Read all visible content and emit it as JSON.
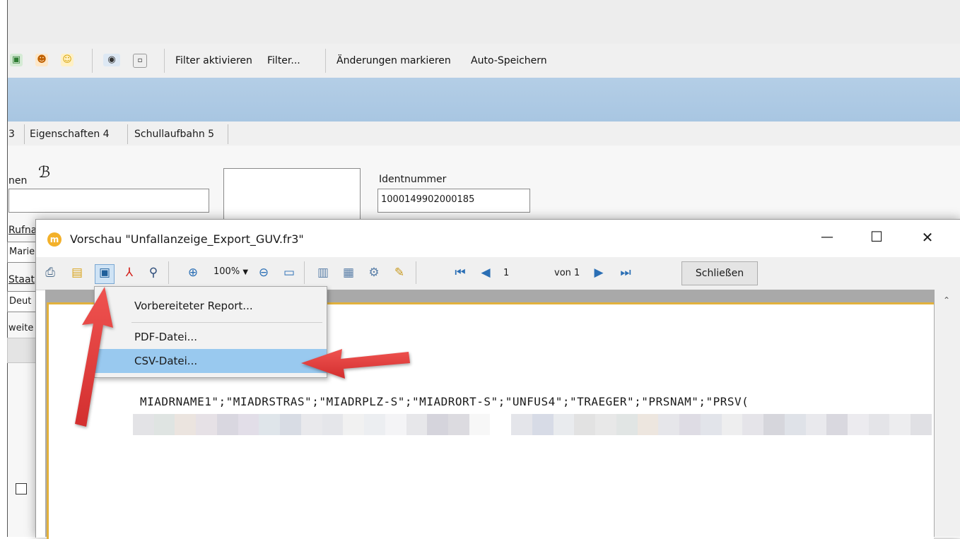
{
  "app": {
    "toolbar": {
      "filter_activate": "Filter aktivieren",
      "filter": "Filter...",
      "mark_changes": "Änderungen markieren",
      "auto_save": "Auto-Speichern"
    },
    "tabs": [
      "3",
      "Eigenschaften 4",
      "Schullaufbahn 5"
    ],
    "form": {
      "name_label": "nen",
      "identnummer_label": "Identnummer",
      "identnummer_value": "1000149902000185",
      "rufname_label": "Rufna",
      "rufname_value": "Marie",
      "staat_label": "Staat",
      "staat_value": "Deut",
      "weitere_label": "weite"
    }
  },
  "dialog": {
    "title": "Vorschau \"Unfallanzeige_Export_GUV.fr3\"",
    "zoom": "100%",
    "page_current": "1",
    "page_of": "von 1",
    "close_button": "Schließen",
    "window_controls": {
      "minimize": "—",
      "maximize": "☐",
      "close": "✕"
    },
    "report_line": "MIADRNAME1\";\"MIADRSTRAS\";\"MIADRPLZ-S\";\"MIADRORT-S\";\"UNFUS4\";\"TRAEGER\";\"PRSNAM\";\"PRSV("
  },
  "save_menu": {
    "items": [
      "Vorbereiteter Report...",
      "PDF-Datei...",
      "CSV-Datei..."
    ],
    "highlighted_index": 2
  },
  "colors": {
    "accent_band": "#a8c6e2",
    "menu_highlight": "#99c9ef",
    "page_border": "#e2b13c",
    "arrow": "#e53935"
  }
}
